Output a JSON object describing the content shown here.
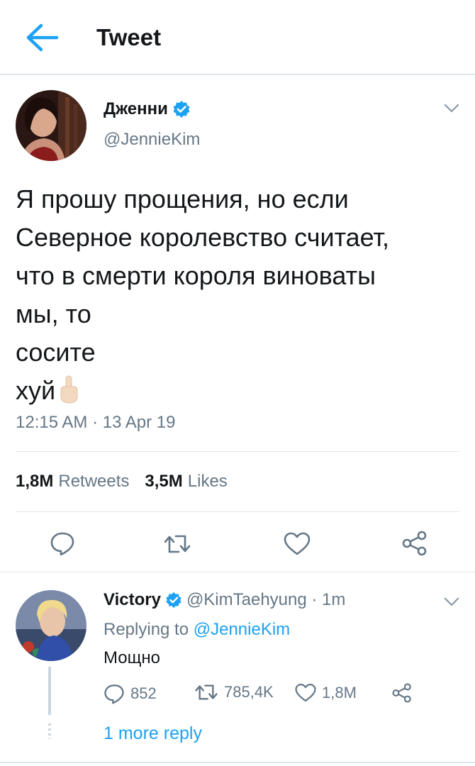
{
  "header": {
    "title": "Tweet"
  },
  "tweet": {
    "author_name": "Дженни",
    "author_handle": "@JennieKim",
    "text_lines": [
      "Я прошу прощения, но если",
      "Северное королевство считает,",
      "что в смерти короля виноваты",
      "мы, то",
      "сосите",
      "хуй"
    ],
    "emoji": "🖕🏻",
    "timestamp": "12:15 AM · 13 Apr 19",
    "retweets_count": "1,8M",
    "retweets_label": "Retweets",
    "likes_count": "3,5M",
    "likes_label": "Likes"
  },
  "reply": {
    "author_name": "Victory",
    "author_handle": "@KimTaehyung · 1m",
    "replying_prefix": "Replying to",
    "replying_mention": "@JennieKim",
    "text": "Мощно",
    "reply_count": "852",
    "retweet_count": "785,4K",
    "like_count": "1,8M",
    "more_replies": "1 more reply"
  },
  "colors": {
    "accent": "#1da1f2",
    "text": "#14171a",
    "muted": "#657786",
    "divider": "#e1e6ea",
    "verified": "#1da1f2"
  },
  "icons": [
    "back-arrow-icon",
    "verified-badge-icon",
    "chevron-down-icon",
    "reply-icon",
    "retweet-icon",
    "like-icon",
    "share-icon"
  ]
}
